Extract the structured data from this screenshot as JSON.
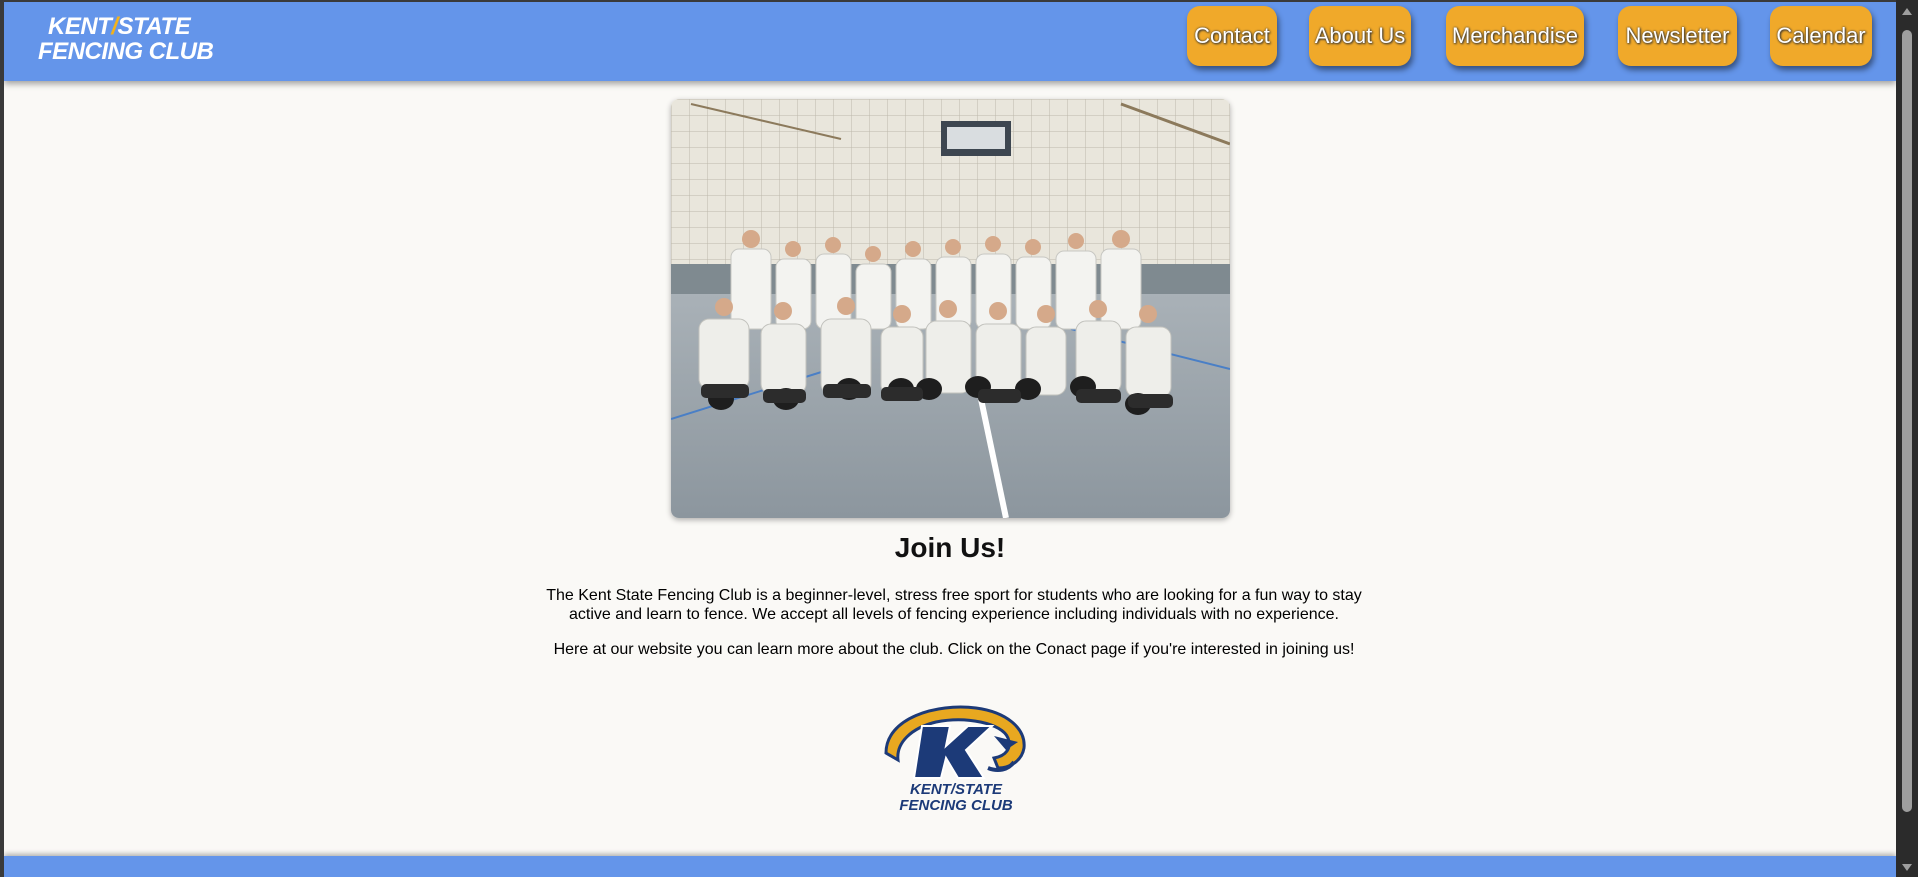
{
  "header": {
    "brand_line1": "KENT",
    "brand_slash": "/",
    "brand_line1b": "STATE",
    "brand_line2": "FENCING CLUB",
    "nav": [
      {
        "label": "Contact"
      },
      {
        "label": "About Us"
      },
      {
        "label": "Merchandise"
      },
      {
        "label": "Newsletter"
      },
      {
        "label": "Calendar"
      }
    ]
  },
  "main": {
    "photo_alt": "Kent State Fencing Club team photo",
    "title": "Join Us!",
    "paragraph1": "The Kent State Fencing Club is a beginner-level, stress free sport for students who are looking for a fun way to stay active and learn to fence. We accept all levels of fencing experience including individuals with no experience.",
    "paragraph2": "Here at our website you can learn more about the club. Click on the Conact page if you're interested in joining us!",
    "logo_line1": "KENT/STATE",
    "logo_line2": "FENCING CLUB"
  },
  "colors": {
    "header_bg": "#6495ea",
    "nav_button_bg": "#f0a92a",
    "page_bg": "#faf9f6",
    "logo_navy": "#1c3a78",
    "logo_gold": "#e8a820"
  }
}
